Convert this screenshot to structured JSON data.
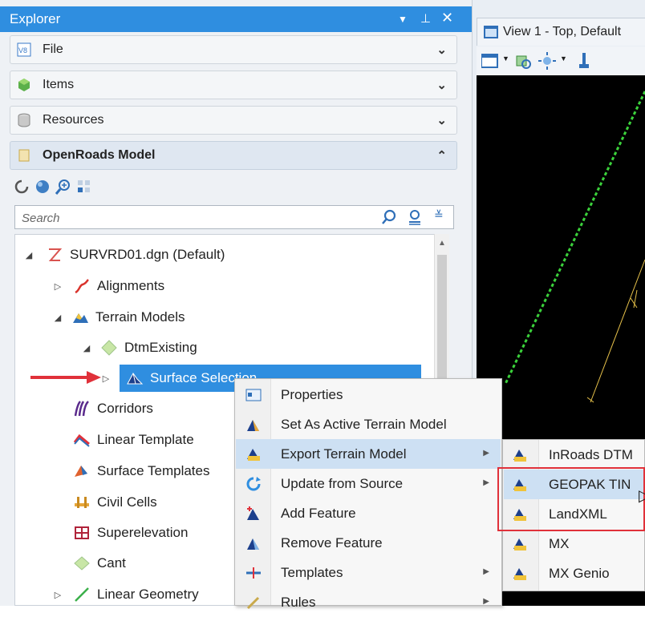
{
  "explorer": {
    "title": "Explorer",
    "sections": [
      {
        "label": "File"
      },
      {
        "label": "Items"
      },
      {
        "label": "Resources"
      },
      {
        "label": "OpenRoads Model"
      }
    ],
    "search": {
      "placeholder": "Search"
    },
    "tree": {
      "root": "SURVRD01.dgn (Default)",
      "alignments": "Alignments",
      "terrain_models": "Terrain Models",
      "dtm_existing": "DtmExisting",
      "surface_selection": "Surface Selection",
      "corridors": "Corridors",
      "linear_template": "Linear Template",
      "surface_templates": "Surface Templates",
      "civil_cells": "Civil Cells",
      "superelevation": "Superelevation",
      "cant": "Cant",
      "linear_geometry": "Linear Geometry"
    }
  },
  "view": {
    "tab_title": "View 1 - Top, Default"
  },
  "context_menu": {
    "items": [
      {
        "label": "Properties"
      },
      {
        "label": "Set As Active Terrain Model"
      },
      {
        "label": "Export Terrain Model"
      },
      {
        "label": "Update from Source"
      },
      {
        "label": "Add Feature"
      },
      {
        "label": "Remove Feature"
      },
      {
        "label": "Templates"
      },
      {
        "label": "Rules"
      }
    ],
    "export_submenu": [
      {
        "label": "InRoads DTM"
      },
      {
        "label": "GEOPAK TIN"
      },
      {
        "label": "LandXML"
      },
      {
        "label": "MX"
      },
      {
        "label": "MX Genio"
      }
    ]
  },
  "colors": {
    "accent": "#2f8ee0",
    "menu_highlight": "#cde0f3",
    "annotation_red": "#e0313a",
    "viewport_bg": "#000000",
    "survey_line": "#3bd13b",
    "alignment_line": "#e6c14a"
  }
}
